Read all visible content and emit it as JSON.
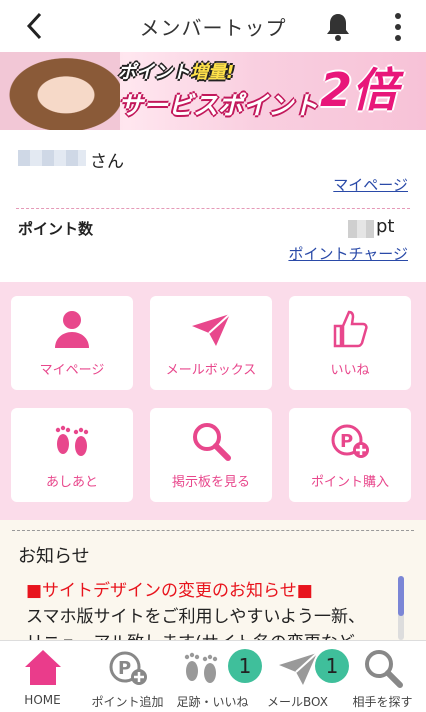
{
  "header": {
    "title": "メンバートップ"
  },
  "banner": {
    "line1_a": "ポイント",
    "line1_b": "増量!",
    "line2": "サービスポイント",
    "multiplier": "2倍"
  },
  "user": {
    "suffix": "さん",
    "mypage_link": "マイページ",
    "points_label": "ポイント数",
    "points_unit": "pt",
    "charge_link": "ポイントチャージ"
  },
  "grid": [
    {
      "label": "マイページ",
      "icon": "person-icon"
    },
    {
      "label": "メールボックス",
      "icon": "paper-plane-icon"
    },
    {
      "label": "いいね",
      "icon": "thumbs-up-icon"
    },
    {
      "label": "あしあと",
      "icon": "footprints-icon"
    },
    {
      "label": "掲示板を見る",
      "icon": "magnifier-icon"
    },
    {
      "label": "ポイント購入",
      "icon": "point-plus-icon"
    }
  ],
  "news": {
    "heading": "お知らせ",
    "title": "■サイトデザインの変更のお知らせ■",
    "body_line1": "スマホ版サイトをご利用しやすいよう一新、",
    "body_line2": "リニューアル致します(サイト名の変更など"
  },
  "tabbar": [
    {
      "label": "HOME",
      "icon": "home-icon"
    },
    {
      "label": "ポイント追加",
      "icon": "point-plus-icon"
    },
    {
      "label": "足跡・いいね",
      "icon": "footprints-icon",
      "badge": "1"
    },
    {
      "label": "メールBOX",
      "icon": "paper-plane-icon",
      "badge": "1"
    },
    {
      "label": "相手を探す",
      "icon": "magnifier-icon"
    }
  ],
  "colors": {
    "accent": "#e8478c",
    "home_active": "#ea3c8b",
    "badge": "#3fbf9b",
    "link": "#2a4aa8"
  }
}
